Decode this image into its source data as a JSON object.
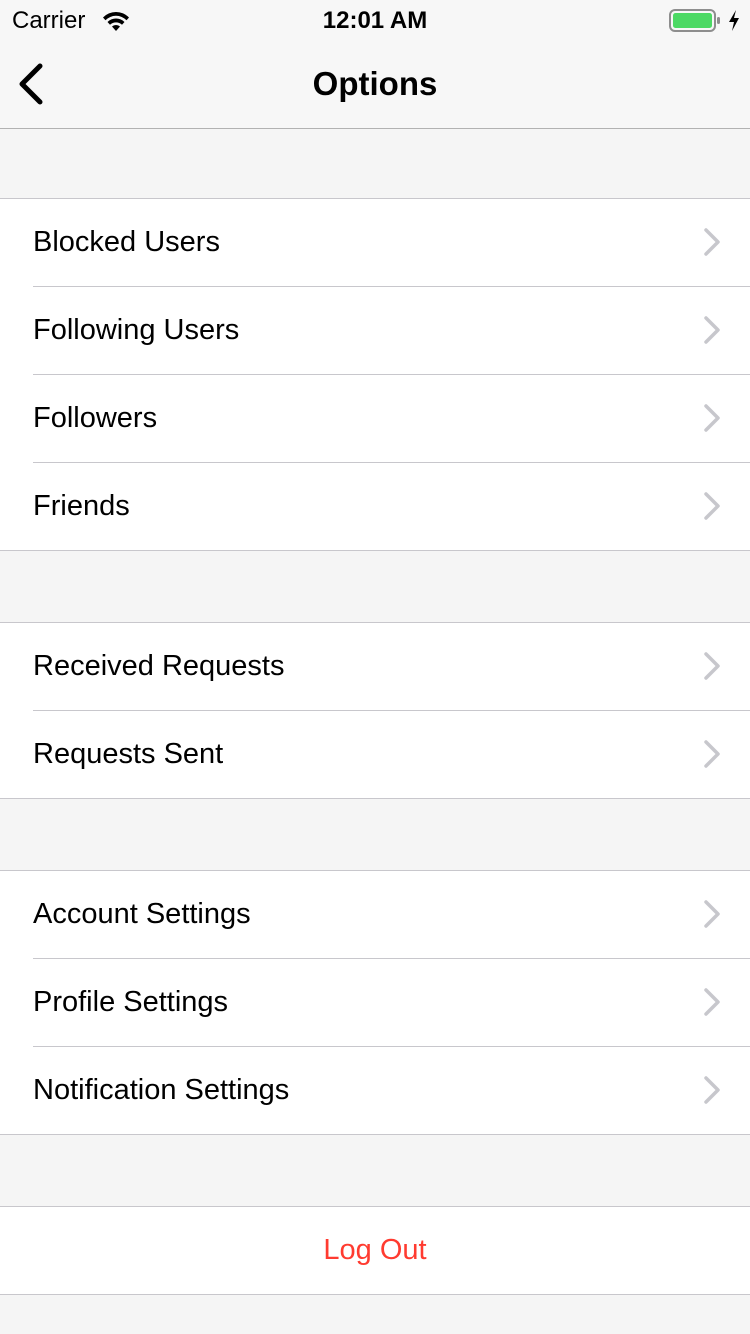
{
  "status_bar": {
    "carrier": "Carrier",
    "time": "12:01 AM",
    "wifi_icon": "wifi-icon",
    "battery_icon": "battery-icon",
    "charging_icon": "charging-bolt-icon",
    "battery_color": "#4cd964"
  },
  "nav": {
    "title": "Options",
    "back_icon": "chevron-left-icon"
  },
  "groups": [
    {
      "items": [
        {
          "label": "Blocked Users"
        },
        {
          "label": "Following Users"
        },
        {
          "label": "Followers"
        },
        {
          "label": "Friends"
        }
      ]
    },
    {
      "items": [
        {
          "label": "Received Requests"
        },
        {
          "label": "Requests Sent"
        }
      ]
    },
    {
      "items": [
        {
          "label": "Account Settings"
        },
        {
          "label": "Profile Settings"
        },
        {
          "label": "Notification Settings"
        }
      ]
    }
  ],
  "logout": {
    "label": "Log Out",
    "color": "#ff3b30"
  },
  "colors": {
    "background": "#f5f5f5",
    "cell": "#ffffff",
    "separator": "#c8c7cc",
    "chevron": "#c7c7cc"
  }
}
